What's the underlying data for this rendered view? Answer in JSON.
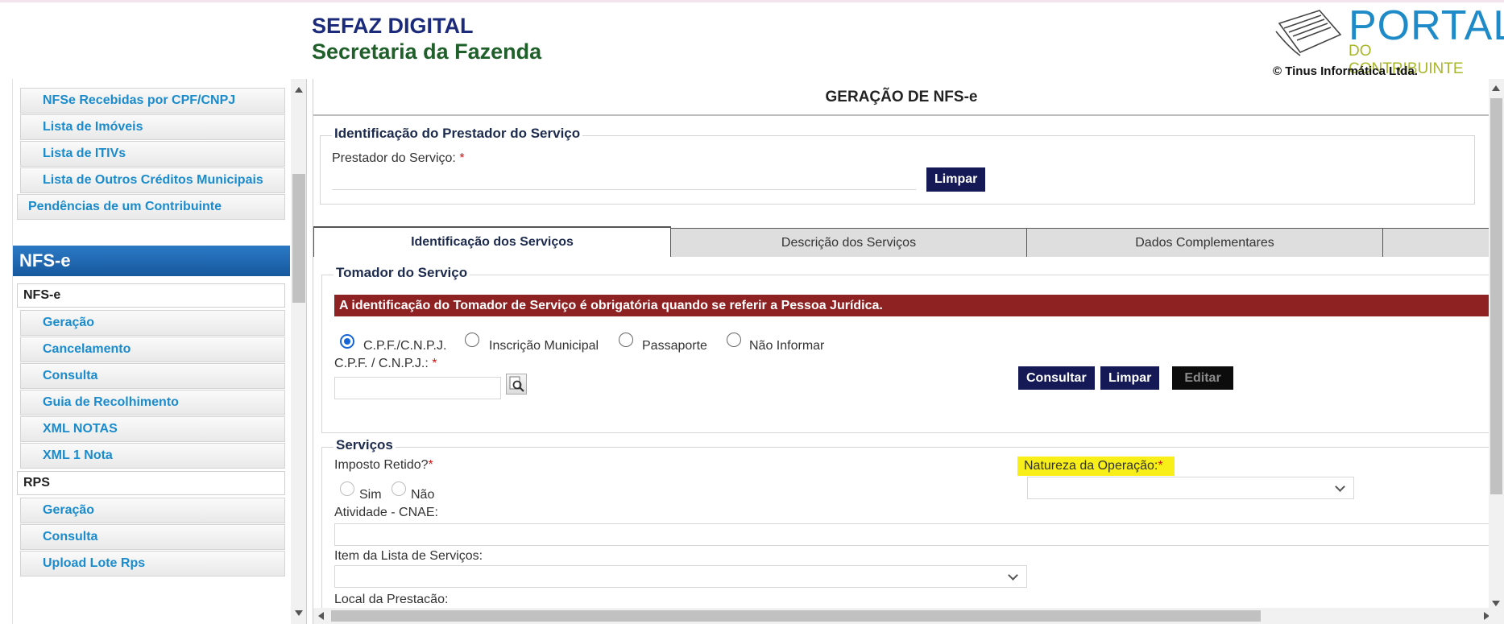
{
  "header": {
    "brand_line1": "SEFAZ DIGITAL",
    "brand_line2": "Secretaria da Fazenda",
    "portal_word": "PORTAL",
    "portal_sub": "DO CONTRIBUINTE",
    "copyright": "© Tinus Informática Ltda."
  },
  "sidebar": {
    "items_top": [
      "NFSe Recebidas por CPF/CNPJ",
      "Lista de Imóveis",
      "Lista de ITIVs",
      "Lista de Outros Créditos Municipais",
      "Pendências de um Contribuinte"
    ],
    "section_title": "NFS-e",
    "group_nfse": "NFS-e",
    "nfse_items": [
      "Geração",
      "Cancelamento",
      "Consulta",
      "Guia de Recolhimento",
      "XML NOTAS",
      "XML 1 Nota"
    ],
    "group_rps": "RPS",
    "rps_items": [
      "Geração",
      "Consulta",
      "Upload Lote Rps"
    ]
  },
  "main": {
    "page_title": "GERAÇÃO DE NFS-e",
    "prestador": {
      "legend": "Identificação do Prestador do Serviço",
      "label": "Prestador do Serviço:",
      "required_mark": "*",
      "value": "",
      "clear_label": "Limpar"
    },
    "tabs": [
      "Identificação dos Serviços",
      "Descrição dos Serviços",
      "Dados Complementares"
    ],
    "active_tab": "Identificação dos Serviços",
    "tomador": {
      "legend": "Tomador do Serviço",
      "alert": "A identificação do Tomador de Serviço é obrigatória quando se referir a Pessoa Jurídica.",
      "radio_options": [
        "C.P.F./C.N.P.J.",
        "Inscrição Municipal",
        "Passaporte",
        "Não Informar"
      ],
      "selected_option": "C.P.F./C.N.P.J.",
      "doc_label": "C.P.F. / C.N.P.J.:",
      "required_mark": "*",
      "doc_value": "",
      "consult_label": "Consultar",
      "clear_label": "Limpar",
      "edit_label": "Editar"
    },
    "servicos": {
      "legend": "Serviços",
      "imposto_label": "Imposto Retido?",
      "required_mark": "*",
      "imposto_options": [
        "Sim",
        "Não"
      ],
      "natureza_label": "Natureza da Operação:",
      "natureza_value": "",
      "cnae_label": "Atividade - CNAE:",
      "cnae_value": "",
      "item_label": "Item da Lista de Serviços:",
      "item_value": "",
      "local_label": "Local da Prestacão:"
    }
  },
  "colors": {
    "brand_blue": "#1b2a7a",
    "brand_green": "#1f5f2a",
    "sidebar_link": "#1a8bcc",
    "section_header": "#1e66b0",
    "button_bg": "#151a56",
    "alert_bg": "#8e2121",
    "highlight": "#f7ef17"
  }
}
